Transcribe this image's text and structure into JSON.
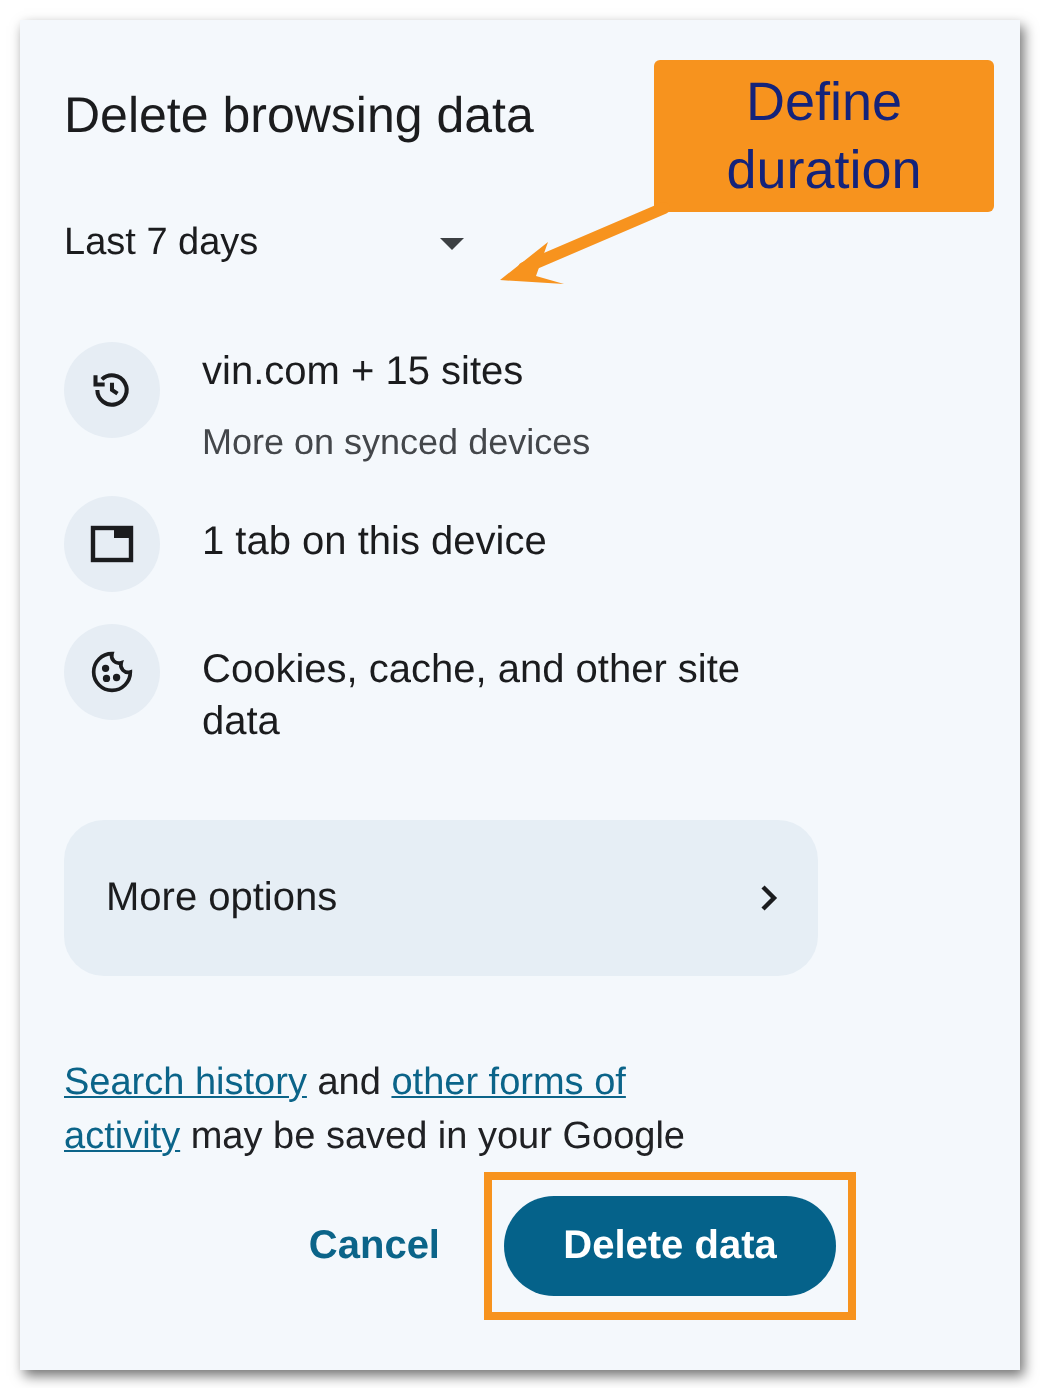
{
  "dialog": {
    "title": "Delete browsing data",
    "time_range": {
      "value": "Last 7 days"
    },
    "items": [
      {
        "kind": "history",
        "label": "vin.com + 15 sites",
        "detail": "More on synced devices"
      },
      {
        "kind": "tab",
        "label": "1 tab on this device"
      },
      {
        "kind": "cookie",
        "label": "Cookies, cache, and other site data"
      }
    ],
    "more_options": {
      "label": "More options"
    },
    "notice": [
      {
        "kind": "link",
        "text": "Search history"
      },
      {
        "kind": "text",
        "text": " and "
      },
      {
        "kind": "link",
        "text": "other forms of"
      },
      {
        "kind": "link",
        "text": "activity"
      },
      {
        "kind": "text",
        "text": " may be saved in your Google"
      }
    ],
    "buttons": [
      {
        "label": "Cancel",
        "kind": "text"
      },
      {
        "label": "Delete data",
        "kind": "primary",
        "highlighted": true
      }
    ]
  },
  "annotation": {
    "callout": "Define duration"
  }
}
